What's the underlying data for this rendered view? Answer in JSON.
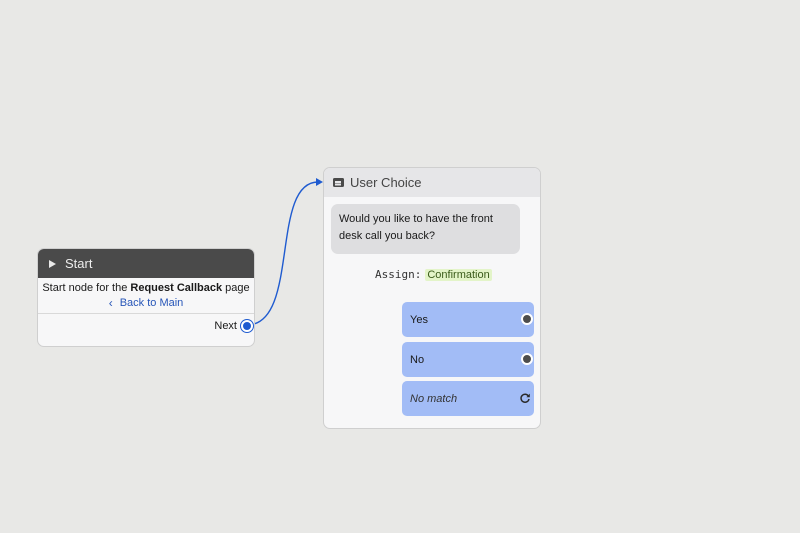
{
  "start_node": {
    "title": "Start",
    "description_prefix": "Start node for the ",
    "description_page": "Request Callback",
    "description_suffix": " page",
    "back_link": "Back to Main",
    "next_label": "Next"
  },
  "choice_node": {
    "title": "User Choice",
    "message": "Would you like to have the front desk call you back?",
    "assign_label": "Assign:",
    "assign_value": "Confirmation",
    "options": [
      {
        "label": "Yes"
      },
      {
        "label": "No"
      },
      {
        "label": "No match"
      }
    ]
  },
  "colors": {
    "canvas_bg": "#e8e8e6",
    "start_header": "#4a4a4a",
    "option_bg": "#a2bcf6",
    "connector": "#1f5bd0",
    "link": "#2756b8",
    "assign_highlight": "#e3f4c8"
  },
  "icons": {
    "start": "play-icon",
    "choice": "chat-icon",
    "back": "chevron-left-icon",
    "no_match": "refresh-icon"
  }
}
